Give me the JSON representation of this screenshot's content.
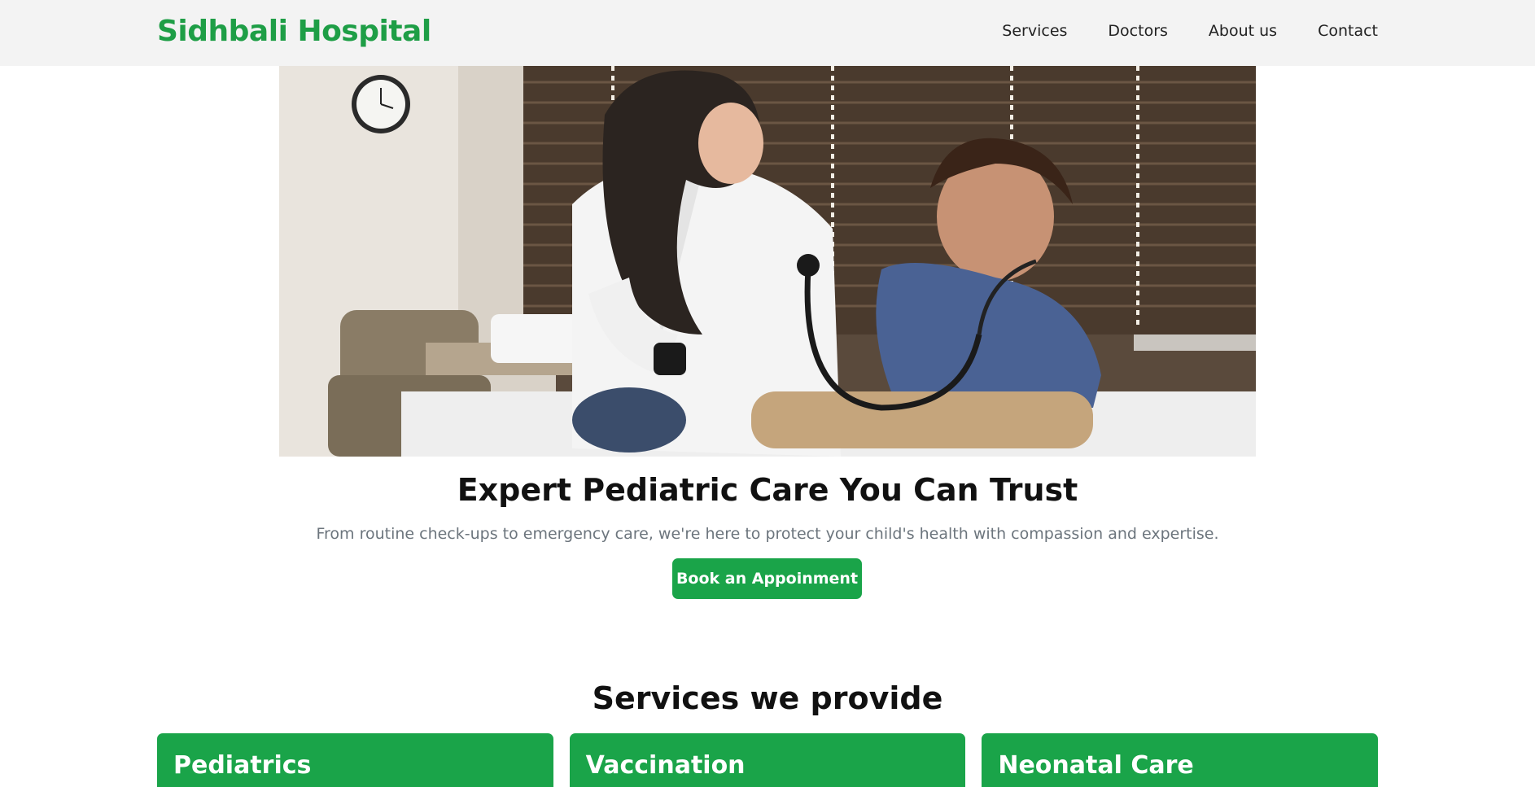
{
  "brand": "Sidhbali Hospital",
  "nav": {
    "services": "Services",
    "doctors": "Doctors",
    "about": "About us",
    "contact": "Contact"
  },
  "hero": {
    "title": "Expert Pediatric Care You Can Trust",
    "subtitle": "From routine check-ups to emergency care, we're here to protect your child's health with compassion and expertise.",
    "cta": "Book an Appoinment"
  },
  "services": {
    "title": "Services we provide",
    "cards": [
      {
        "title": "Pediatrics"
      },
      {
        "title": "Vaccination"
      },
      {
        "title": "Neonatal Care"
      }
    ]
  },
  "colors": {
    "brand": "#1e9e46",
    "primary": "#1aa449",
    "navbar": "#f3f3f3",
    "muted": "#6c757d"
  }
}
